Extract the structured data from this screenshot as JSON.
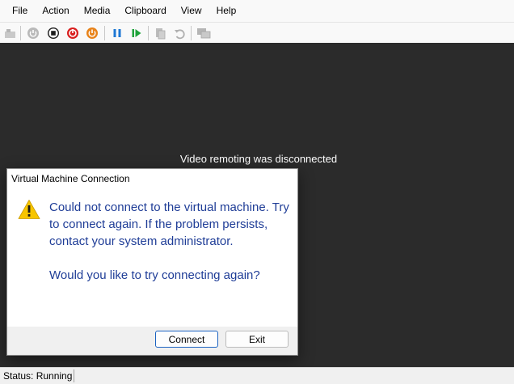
{
  "menubar": {
    "items": [
      "File",
      "Action",
      "Media",
      "Clipboard",
      "View",
      "Help"
    ]
  },
  "toolbar": {
    "buttons": [
      "ctrl-alt-del-icon",
      "start-icon",
      "turn-off-icon",
      "shut-down-icon",
      "power-icon",
      "pause-icon",
      "reset-icon",
      "checkpoint-icon",
      "revert-icon",
      "enhanced-session-icon"
    ]
  },
  "screen": {
    "message": "Video remoting was disconnected"
  },
  "dialog": {
    "title": "Virtual Machine Connection",
    "message": "Could not connect to the virtual machine. Try to connect again. If the problem persists, contact your system administrator.",
    "question": "Would you like to try connecting again?",
    "connect_label": "Connect",
    "exit_label": "Exit"
  },
  "status": {
    "text": "Status: Running"
  },
  "colors": {
    "dialog_text": "#1f3d97",
    "screen_bg": "#2b2b2b",
    "warning": "#f7c500",
    "primary_border": "#1a62c1"
  }
}
